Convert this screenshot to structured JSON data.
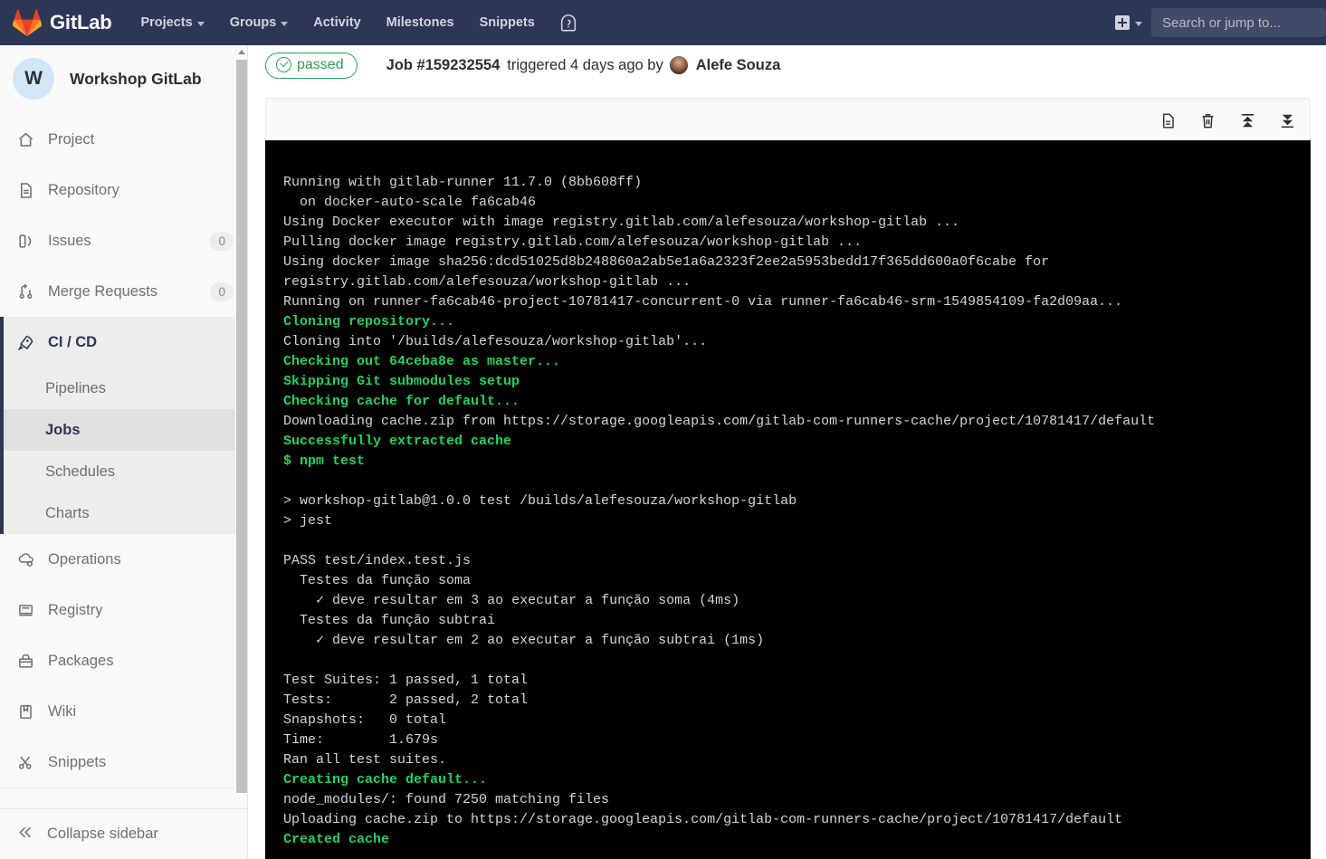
{
  "navbar": {
    "brand": "GitLab",
    "links": [
      {
        "label": "Projects",
        "has_caret": true
      },
      {
        "label": "Groups",
        "has_caret": true
      },
      {
        "label": "Activity",
        "has_caret": false
      },
      {
        "label": "Milestones",
        "has_caret": false
      },
      {
        "label": "Snippets",
        "has_caret": false
      }
    ],
    "help_icon": "help-circle-icon",
    "plus_icon": "plus-square-icon",
    "search_placeholder": "Search or jump to..."
  },
  "sidebar": {
    "project_initial": "W",
    "project_name": "Workshop GitLab",
    "items": [
      {
        "label": "Project",
        "icon": "home-icon",
        "badge": ""
      },
      {
        "label": "Repository",
        "icon": "document-icon",
        "badge": ""
      },
      {
        "label": "Issues",
        "icon": "issues-icon",
        "badge": "0"
      },
      {
        "label": "Merge Requests",
        "icon": "merge-request-icon",
        "badge": "0"
      }
    ],
    "cicd": {
      "label": "CI / CD",
      "icon": "rocket-icon",
      "sub_items": [
        {
          "label": "Pipelines",
          "active": false
        },
        {
          "label": "Jobs",
          "active": true
        },
        {
          "label": "Schedules",
          "active": false
        },
        {
          "label": "Charts",
          "active": false
        }
      ]
    },
    "items_bottom": [
      {
        "label": "Operations",
        "icon": "cloud-gear-icon",
        "badge": ""
      },
      {
        "label": "Registry",
        "icon": "registry-icon",
        "badge": ""
      },
      {
        "label": "Packages",
        "icon": "package-icon",
        "badge": ""
      },
      {
        "label": "Wiki",
        "icon": "book-icon",
        "badge": ""
      },
      {
        "label": "Snippets",
        "icon": "scissors-icon",
        "badge": ""
      }
    ],
    "collapse_label": "Collapse sidebar",
    "collapse_icon": "chevron-double-left-icon"
  },
  "job": {
    "status": "passed",
    "status_icon": "check-circle-icon",
    "status_color": "#2e9e4e",
    "job_number": "Job #159232554",
    "triggered_text": "triggered 4 days ago by",
    "author": "Alefe Souza"
  },
  "log_toolbar": {
    "buttons": [
      {
        "icon": "raw-log-icon",
        "title": "Show complete raw"
      },
      {
        "icon": "erase-trash-icon",
        "title": "Erase job log"
      },
      {
        "icon": "scroll-to-top-icon",
        "title": "Scroll to top"
      },
      {
        "icon": "scroll-to-bottom-icon",
        "title": "Scroll to bottom"
      }
    ]
  },
  "log_lines": [
    {
      "text": "Running with gitlab-runner 11.7.0 (8bb608ff)",
      "green": false
    },
    {
      "text": "  on docker-auto-scale fa6cab46",
      "green": false
    },
    {
      "text": "Using Docker executor with image registry.gitlab.com/alefesouza/workshop-gitlab ...",
      "green": false
    },
    {
      "text": "Pulling docker image registry.gitlab.com/alefesouza/workshop-gitlab ...",
      "green": false
    },
    {
      "text": "Using docker image sha256:dcd51025d8b248860a2ab5e1a6a2323f2ee2a5953bedd17f365dd600a0f6cabe for",
      "green": false
    },
    {
      "text": "registry.gitlab.com/alefesouza/workshop-gitlab ...",
      "green": false
    },
    {
      "text": "Running on runner-fa6cab46-project-10781417-concurrent-0 via runner-fa6cab46-srm-1549854109-fa2d09aa...",
      "green": false
    },
    {
      "text": "Cloning repository...",
      "green": true
    },
    {
      "text": "Cloning into '/builds/alefesouza/workshop-gitlab'...",
      "green": false
    },
    {
      "text": "Checking out 64ceba8e as master...",
      "green": true
    },
    {
      "text": "Skipping Git submodules setup",
      "green": true
    },
    {
      "text": "Checking cache for default...",
      "green": true
    },
    {
      "text": "Downloading cache.zip from https://storage.googleapis.com/gitlab-com-runners-cache/project/10781417/default",
      "green": false
    },
    {
      "text": "Successfully extracted cache",
      "green": true
    },
    {
      "text": "$ npm test",
      "green": true
    },
    {
      "text": "",
      "green": false
    },
    {
      "text": "> workshop-gitlab@1.0.0 test /builds/alefesouza/workshop-gitlab",
      "green": false
    },
    {
      "text": "> jest",
      "green": false
    },
    {
      "text": "",
      "green": false
    },
    {
      "text": "PASS test/index.test.js",
      "green": false
    },
    {
      "text": "  Testes da função soma",
      "green": false
    },
    {
      "text": "    ✓ deve resultar em 3 ao executar a função soma (4ms)",
      "green": false
    },
    {
      "text": "  Testes da função subtrai",
      "green": false
    },
    {
      "text": "    ✓ deve resultar em 2 ao executar a função subtrai (1ms)",
      "green": false
    },
    {
      "text": "",
      "green": false
    },
    {
      "text": "Test Suites: 1 passed, 1 total",
      "green": false
    },
    {
      "text": "Tests:       2 passed, 2 total",
      "green": false
    },
    {
      "text": "Snapshots:   0 total",
      "green": false
    },
    {
      "text": "Time:        1.679s",
      "green": false
    },
    {
      "text": "Ran all test suites.",
      "green": false
    },
    {
      "text": "Creating cache default...",
      "green": true
    },
    {
      "text": "node_modules/: found 7250 matching files",
      "green": false
    },
    {
      "text": "Uploading cache.zip to https://storage.googleapis.com/gitlab-com-runners-cache/project/10781417/default",
      "green": false
    },
    {
      "text": "Created cache",
      "green": true
    }
  ]
}
